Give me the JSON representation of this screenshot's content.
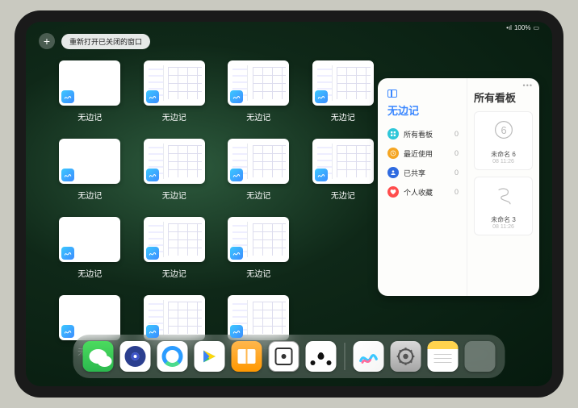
{
  "status": {
    "battery": "100%",
    "signal": "•ıl"
  },
  "top": {
    "plus": "+",
    "reopen_label": "重新打开已关闭的窗口"
  },
  "grid": {
    "app_label": "无边记",
    "rows": [
      4,
      4,
      3,
      3
    ]
  },
  "panel": {
    "left_title": "无边记",
    "right_title": "所有看板",
    "more": "•••",
    "categories": [
      {
        "label": "所有看板",
        "count": 0,
        "color": "#2fc7d9"
      },
      {
        "label": "最近使用",
        "count": 0,
        "color": "#f5a623"
      },
      {
        "label": "已共享",
        "count": 0,
        "color": "#2f6be0"
      },
      {
        "label": "个人收藏",
        "count": 0,
        "color": "#ff4d4d"
      }
    ],
    "boards": [
      {
        "name": "未命名 6",
        "sub": "08 11:26",
        "digit": "6"
      },
      {
        "name": "未命名 3",
        "sub": "08 11:26",
        "digit": "3"
      }
    ]
  },
  "dock": {
    "apps": [
      {
        "name": "wechat"
      },
      {
        "name": "browser-quark"
      },
      {
        "name": "browser-q"
      },
      {
        "name": "play"
      },
      {
        "name": "books"
      },
      {
        "name": "dice"
      },
      {
        "name": "nodes"
      }
    ],
    "recent": [
      {
        "name": "freeform"
      },
      {
        "name": "settings"
      },
      {
        "name": "notes"
      },
      {
        "name": "app-folder"
      }
    ]
  }
}
